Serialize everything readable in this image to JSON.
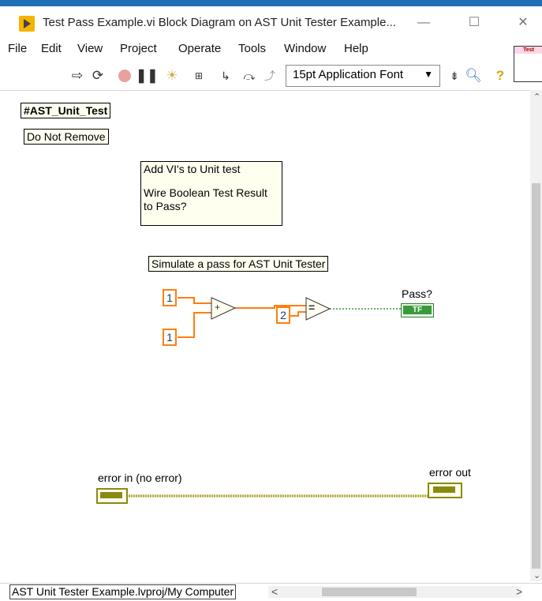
{
  "window": {
    "title": "Test Pass Example.vi Block Diagram on AST Unit Tester Example...",
    "minimize_glyph": "—",
    "maximize_glyph": "☐",
    "close_glyph": "✕"
  },
  "menu": [
    "File",
    "Edit",
    "View",
    "Project",
    "Operate",
    "Tools",
    "Window",
    "Help"
  ],
  "toolbar": {
    "icons": [
      "run-arrow-icon",
      "run-continuously-icon",
      "abort-icon",
      "pause-icon",
      "highlight-execution-icon",
      "retain-wire-values-icon",
      "step-into-icon",
      "step-over-icon",
      "step-out-icon"
    ],
    "font_value": "15pt Application Font",
    "font_arrow": "▼",
    "align_icon": "align-objects-icon",
    "search_icon": "search-icon",
    "help_icon": "context-help-icon"
  },
  "icon_pane": {
    "label": "Test"
  },
  "diagram": {
    "tag_label": "#AST_Unit_Test",
    "do_not_remove": "Do Not Remove",
    "instructions_line1": "Add VI's to Unit test",
    "instructions_line2": "Wire Boolean Test Result",
    "instructions_line3": "to Pass?",
    "simulate_label": "Simulate a pass for AST Unit Tester",
    "const_a": "1",
    "const_b": "1",
    "const_c": "2",
    "add_symbol": "+",
    "equal_symbol": "=",
    "pass_label": "Pass?",
    "pass_terminal": "TF",
    "error_in_label": "error in (no error)",
    "error_out_label": "error out"
  },
  "status": {
    "path": "AST Unit Tester Example.lvproj/My Computer",
    "left_arrow": "<",
    "right_arrow": ">"
  },
  "colors": {
    "numeric_wire": "#ff7f0e",
    "boolean_wire": "#3a9a3a",
    "error_wire": "#8a8a10",
    "label_bg": "#fffff0"
  }
}
